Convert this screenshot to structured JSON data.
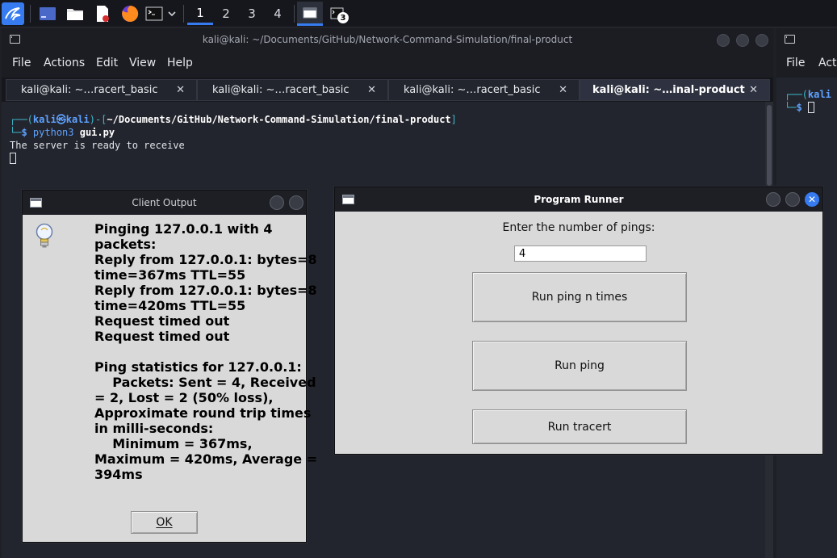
{
  "panel": {
    "workspaces": [
      "1",
      "2",
      "3",
      "4"
    ],
    "active_workspace": 0,
    "task_badge": "3"
  },
  "main_terminal": {
    "title": "kali@kali: ~/Documents/GitHub/Network-Command-Simulation/final-product",
    "menu": [
      "File",
      "Actions",
      "Edit",
      "View",
      "Help"
    ],
    "tabs": [
      {
        "label": "kali@kali: ~…racert_basic"
      },
      {
        "label": "kali@kali: ~…racert_basic"
      },
      {
        "label": "kali@kali: ~…racert_basic"
      },
      {
        "label": "kali@kali: ~…inal-product"
      }
    ],
    "active_tab": 3,
    "prompt_prefix": "┌──(",
    "prompt_user": "kali㉿kali",
    "prompt_mid": ")-[",
    "prompt_path": "~/Documents/GitHub/Network-Command-Simulation/final-product",
    "prompt_suffix": "]",
    "prompt_line2": "└─",
    "prompt_symbol": "$",
    "command_name": "python3",
    "command_arg": "gui.py",
    "output_line": "The server is ready to receive"
  },
  "right_terminal": {
    "menu": [
      "File",
      "Act"
    ],
    "prompt_prefix": "┌──(",
    "prompt_user": "kali",
    "prompt_line2": "└─",
    "prompt_symbol": "$"
  },
  "client_output": {
    "title": "Client Output",
    "message": "Pinging 127.0.0.1 with 4 packets:\nReply from 127.0.0.1: bytes=8 time=367ms TTL=55\nReply from 127.0.0.1: bytes=8 time=420ms TTL=55\nRequest timed out\nRequest timed out\n\nPing statistics for 127.0.0.1:\n    Packets: Sent = 4, Received = 2, Lost = 2 (50% loss),\nApproximate round trip times in milli-seconds:\n    Minimum = 367ms, Maximum = 420ms, Average = 394ms",
    "ok_label": "OK"
  },
  "program_runner": {
    "title": "Program Runner",
    "prompt_label": "Enter the number of pings:",
    "ping_count_value": "4",
    "buttons": {
      "run_ping_n": "Run ping n times",
      "run_ping": "Run ping",
      "run_tracert": "Run tracert"
    }
  },
  "colors": {
    "accent": "#367bf0",
    "terminal_bg": "#23252e",
    "dialog_bg": "#d9d9d9"
  }
}
